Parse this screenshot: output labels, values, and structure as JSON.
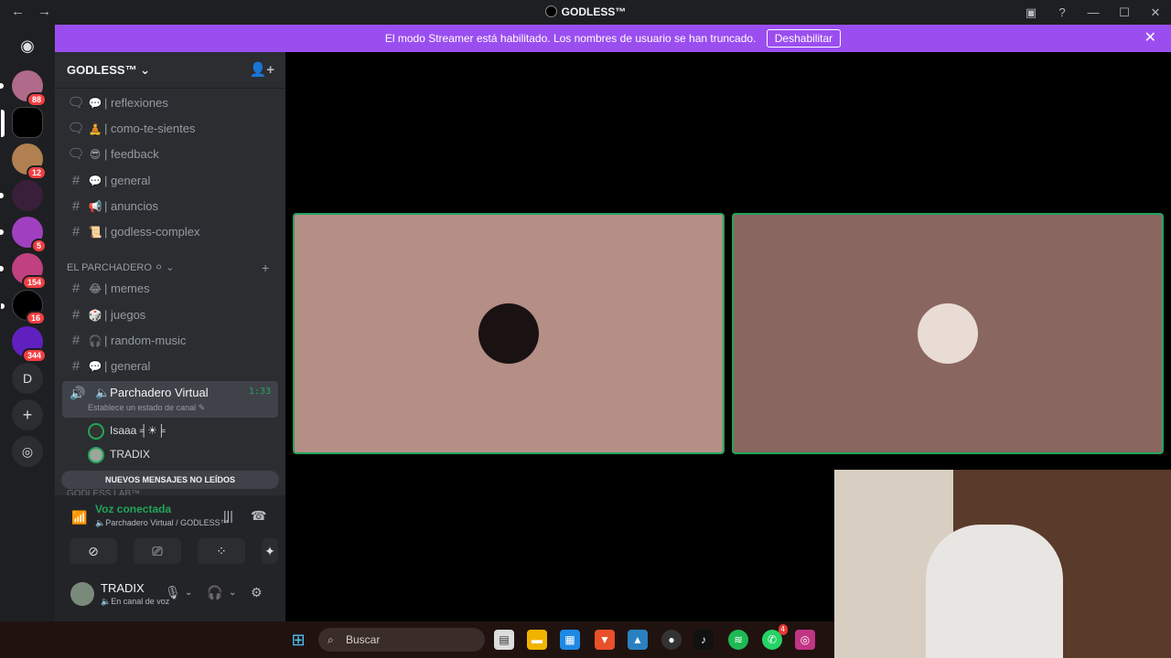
{
  "window": {
    "title": "GODLESS™",
    "back": "←",
    "forward": "→"
  },
  "banner": {
    "text": "El modo Streamer está habilitado. Los nombres de usuario se han truncado.",
    "button": "Deshabilitar"
  },
  "servers": [
    {
      "badge": "88"
    },
    {
      "badge": ""
    },
    {
      "badge": "12"
    },
    {
      "badge": ""
    },
    {
      "badge": "5"
    },
    {
      "badge": "154"
    },
    {
      "badge": "16"
    },
    {
      "badge": "344"
    },
    {
      "letter": "D"
    }
  ],
  "guild": {
    "name": "GODLESS™ ⌄"
  },
  "channels_top": [
    {
      "prefix": "💬",
      "name": "| reflexiones",
      "type": "forum"
    },
    {
      "prefix": "🧘",
      "name": "| como-te-sientes",
      "type": "forum"
    },
    {
      "prefix": "😎",
      "name": "| feedback",
      "type": "forum"
    },
    {
      "prefix": "💬",
      "name": "| general",
      "type": "text"
    },
    {
      "prefix": "📢",
      "name": "| anuncios",
      "type": "text"
    },
    {
      "prefix": "📜",
      "name": "| godless-complex",
      "type": "text"
    }
  ],
  "category_parchadero": {
    "name": "EL PARCHADERO ⚪",
    "chev": "⌄",
    "add": "+"
  },
  "channels_parch": [
    {
      "prefix": "😂",
      "name": "| memes"
    },
    {
      "prefix": "🎲",
      "name": "| juegos"
    },
    {
      "prefix": "🎧",
      "name": "| random-music"
    },
    {
      "prefix": "💬",
      "name": "| general"
    }
  ],
  "voice_channel": {
    "name": "🔈Parchadero Virtual",
    "status": "Establece un estado de canal ✎",
    "time": "1:33"
  },
  "members": [
    {
      "name": "Isaaa ╡☀╞"
    },
    {
      "name": "TRADIX"
    }
  ],
  "new_messages": "NUEVOS MENSAJES NO LEÍDOS",
  "next_category": "GODLESS LAB™",
  "voice_panel": {
    "status": "Voz conectada",
    "location": "🔈Parchadero Virtual / GODLESS™"
  },
  "user": {
    "name": "TRADIX",
    "status": "🔈En canal de voz"
  },
  "taskbar": {
    "search_placeholder": "Buscar",
    "whatsapp_badge": "4"
  },
  "colors": {
    "accent": "#9b4ef0",
    "online": "#23a55a",
    "tile1": "#b58e86",
    "tile2": "#8a6660"
  }
}
